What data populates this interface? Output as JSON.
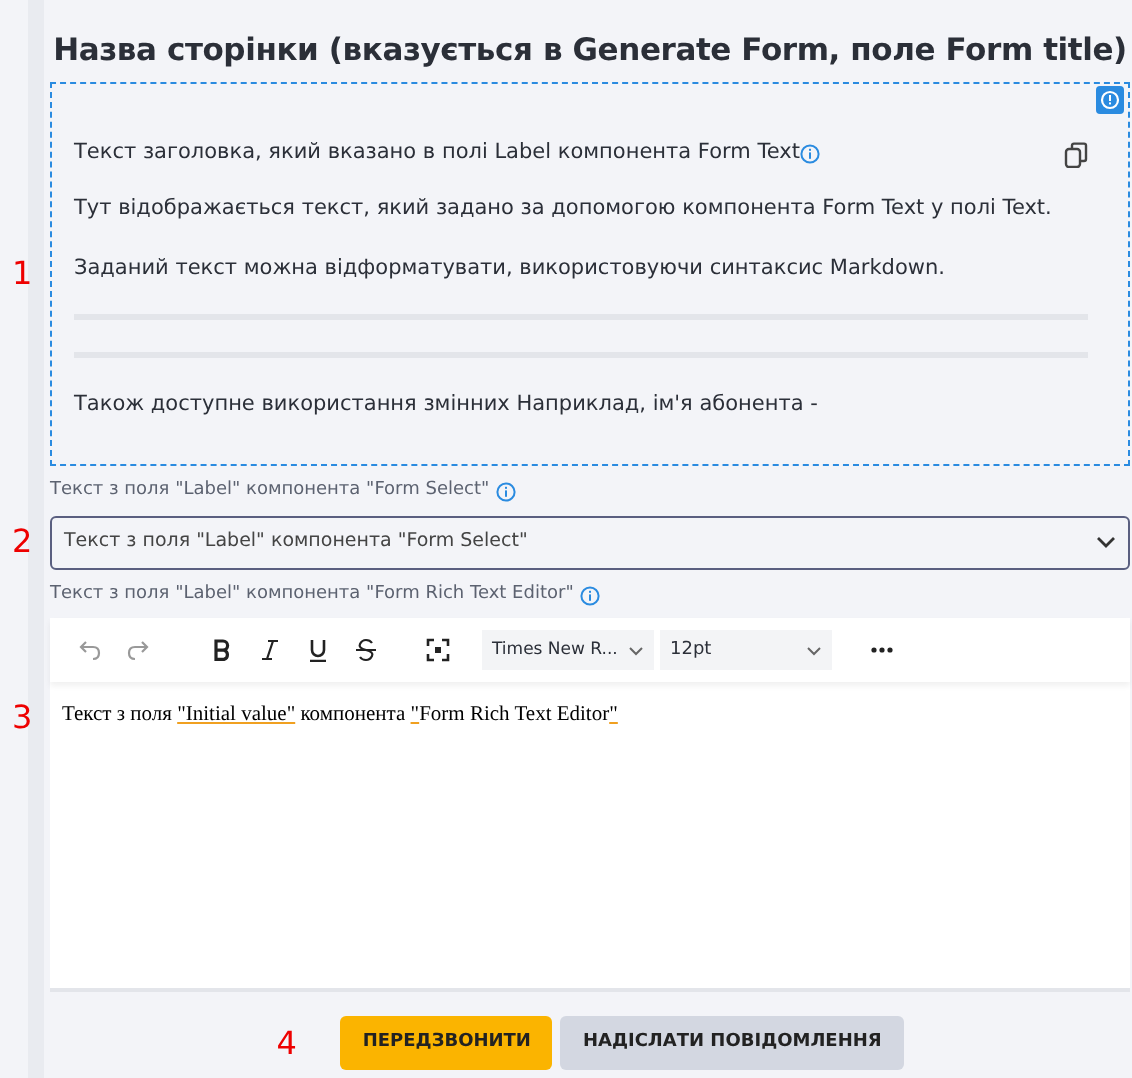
{
  "page_title": "Назва сторінки (вказується в Generate Form, поле Form title)",
  "text_block": {
    "annotation": "1",
    "heading": "Текст заголовка, який вказано в полі Label компонента Form Text",
    "paragraphs": [
      "Тут відображається текст, який задано за допомогою компонента Form Text у полі Text.",
      "Заданий текст можна відформатувати, використовуючи синтаксис Markdown."
    ],
    "footer": "Також доступне використання змінних Наприклад, ім'я абонента -"
  },
  "select": {
    "annotation": "2",
    "label": "Текст з поля \"Label\" компонента \"Form Select\"",
    "value": "Текст з поля \"Label\" компонента \"Form Select\""
  },
  "rich_editor": {
    "annotation": "3",
    "label": "Текст з поля \"Label\" компонента \"Form Rich Text Editor\"",
    "font": "Times New R...",
    "size": "12pt",
    "content": [
      {
        "text": "Текст з поля ",
        "underlined": false
      },
      {
        "text": "\"Initial value\"",
        "underlined": true
      },
      {
        "text": " компонента ",
        "underlined": false
      },
      {
        "text": "\"",
        "underlined": true
      },
      {
        "text": "Form Rich Text Editor",
        "underlined": false
      },
      {
        "text": "\"",
        "underlined": true
      }
    ]
  },
  "actions": {
    "annotation": "4",
    "buttons": [
      {
        "label": "ПЕРЕДЗВОНИТИ",
        "kind": "primary"
      },
      {
        "label": "НАДІСЛАТИ ПОВІДОМЛЕННЯ",
        "kind": "secondary"
      }
    ]
  }
}
